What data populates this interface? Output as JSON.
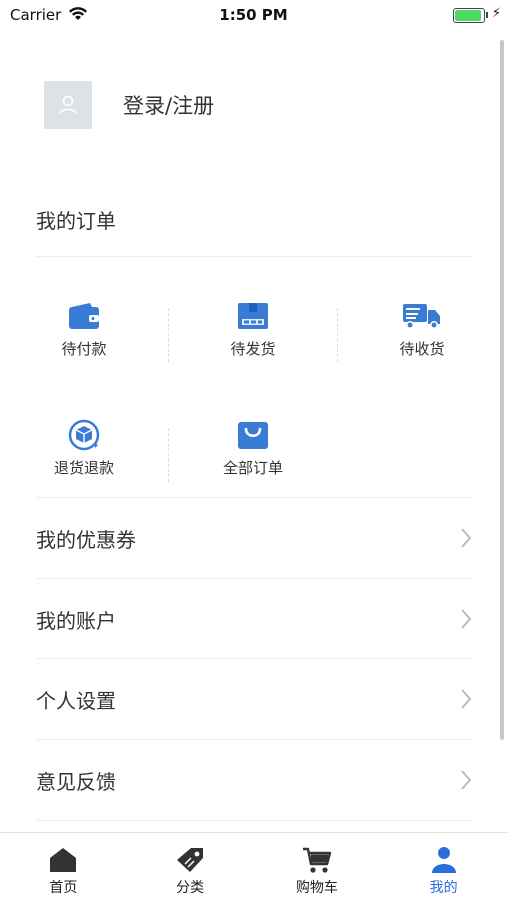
{
  "status_bar": {
    "carrier": "Carrier",
    "time": "1:50 PM",
    "battery_level": 1.0
  },
  "profile": {
    "login_label": "登录/注册"
  },
  "orders": {
    "title": "我的订单",
    "items": [
      {
        "label": "待付款",
        "icon": "wallet-icon"
      },
      {
        "label": "待发货",
        "icon": "package-box-icon"
      },
      {
        "label": "待收货",
        "icon": "delivery-truck-icon"
      },
      {
        "label": "退货退款",
        "icon": "return-box-icon"
      },
      {
        "label": "全部订单",
        "icon": "shopping-bag-icon"
      }
    ]
  },
  "menu": [
    {
      "label": "我的优惠券"
    },
    {
      "label": "我的账户"
    },
    {
      "label": "个人设置"
    },
    {
      "label": "意见反馈"
    }
  ],
  "tabbar": {
    "items": [
      {
        "label": "首页",
        "icon": "home-icon"
      },
      {
        "label": "分类",
        "icon": "tag-icon"
      },
      {
        "label": "购物车",
        "icon": "cart-icon"
      },
      {
        "label": "我的",
        "icon": "user-icon",
        "active": true
      }
    ],
    "active_color": "#2a6ddb",
    "icon_color": "#333333"
  },
  "colors": {
    "accent": "#2a6ddb",
    "icon_blue": "#3a7bd5"
  }
}
